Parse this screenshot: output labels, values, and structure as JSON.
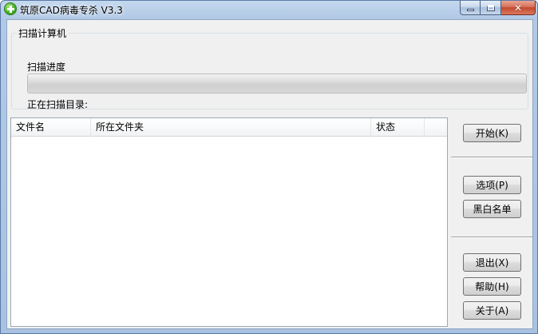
{
  "window": {
    "title": "筑原CAD病毒专杀  V3.3"
  },
  "caption_buttons": {
    "close_glyph": "✕"
  },
  "scan_group": {
    "legend": "扫描计算机",
    "progress_label": "扫描进度",
    "progress_value": 0,
    "scanning_label": "正在扫描目录:"
  },
  "file_list": {
    "columns": [
      "文件名",
      "所在文件夹",
      "状态"
    ],
    "rows": []
  },
  "buttons": {
    "start": "开始(K)",
    "options": "选项(P)",
    "blackwhite": "黑白名单",
    "exit": "退出(X)",
    "help": "帮助(H)",
    "about": "关于(A)"
  },
  "colors": {
    "title_bar": "#b1c9e6",
    "client_bg": "#f0f0f0",
    "close_button": "#c2482c"
  },
  "icons": {
    "app": "green-plus-icon",
    "minimize": "minimize-icon",
    "maximize": "maximize-icon",
    "close": "close-icon"
  }
}
